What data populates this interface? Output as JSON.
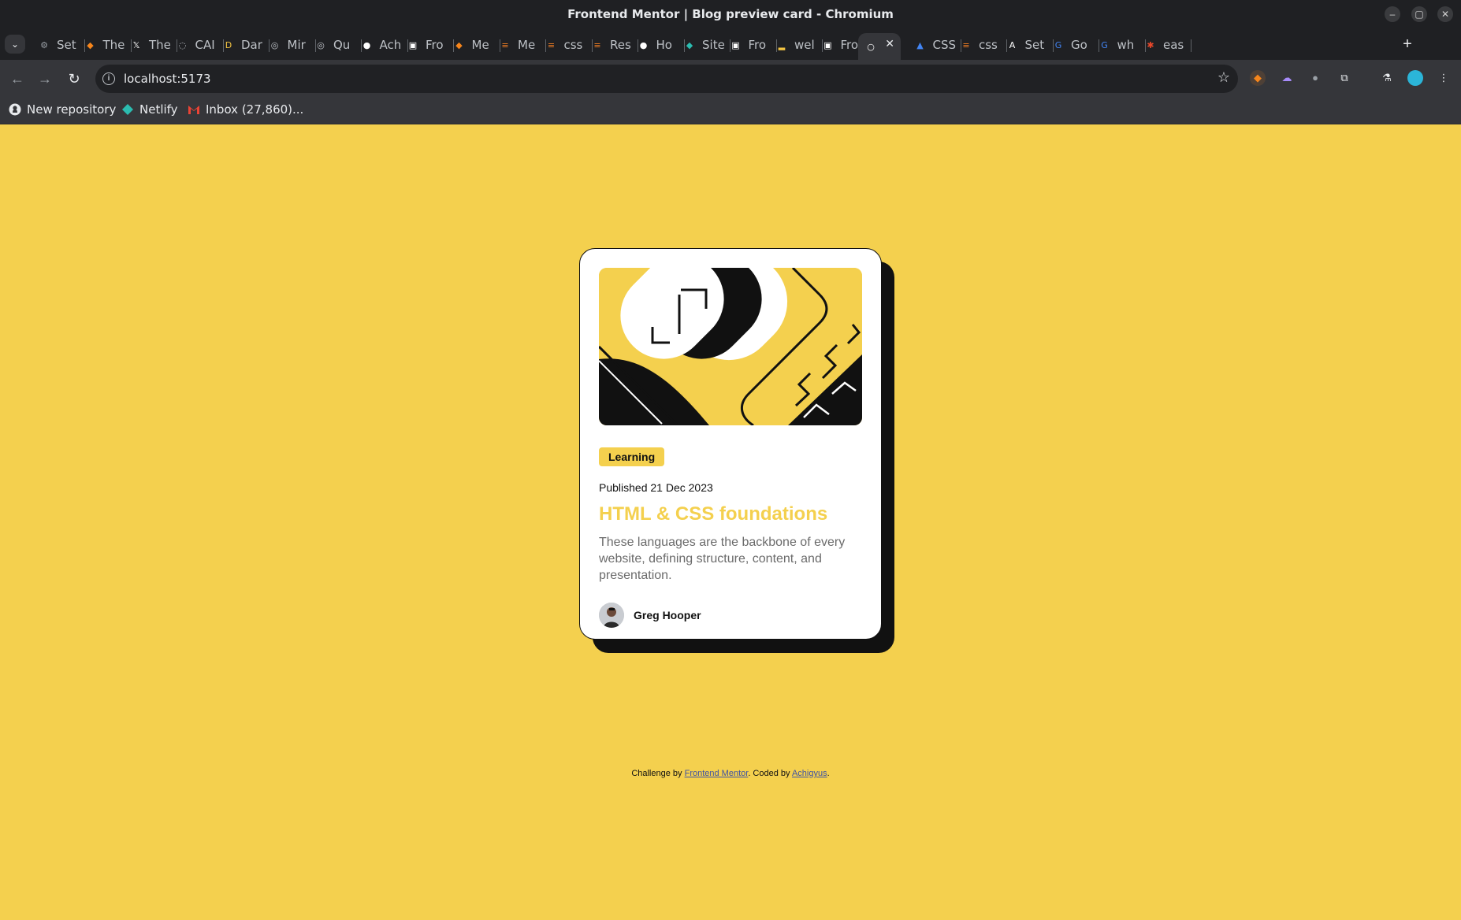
{
  "window": {
    "title": "Frontend Mentor | Blog preview card - Chromium",
    "controls": [
      "–",
      "▢",
      "✕"
    ]
  },
  "tabs": [
    {
      "label": "Set",
      "icon": "gear-icon",
      "color": "#9aa0a6"
    },
    {
      "label": "The",
      "icon": "metamask-icon",
      "color": "#f6851b"
    },
    {
      "label": "The",
      "icon": "x-icon",
      "color": "#ffffff"
    },
    {
      "label": "CAI",
      "icon": "globe-icon",
      "color": "#bdc1c6"
    },
    {
      "label": "Dar",
      "icon": "dart-icon",
      "color": "#f4c542"
    },
    {
      "label": "Mir",
      "icon": "spiral-icon",
      "color": "#bdc1c6"
    },
    {
      "label": "Qu",
      "icon": "spiral-icon",
      "color": "#bdc1c6"
    },
    {
      "label": "Ach",
      "icon": "github-icon",
      "color": "#ffffff"
    },
    {
      "label": "Fro",
      "icon": "frontend-mentor-icon",
      "color": "#ffffff"
    },
    {
      "label": "Me",
      "icon": "metamask-icon",
      "color": "#f6851b"
    },
    {
      "label": "Me",
      "icon": "stackoverflow-icon",
      "color": "#f48024"
    },
    {
      "label": "css",
      "icon": "stackoverflow-icon",
      "color": "#f48024"
    },
    {
      "label": "Res",
      "icon": "stackoverflow-icon",
      "color": "#f48024"
    },
    {
      "label": "Ho",
      "icon": "medium-icon",
      "color": "#ffffff"
    },
    {
      "label": "Site",
      "icon": "netlify-icon",
      "color": "#2bbcb0"
    },
    {
      "label": "Fro",
      "icon": "frontend-mentor-icon",
      "color": "#ffffff"
    },
    {
      "label": "wel",
      "icon": "bar-icon",
      "color": "#f4c542"
    },
    {
      "label": "Fro",
      "icon": "frontend-mentor-icon",
      "color": "#ffffff"
    },
    {
      "label": "",
      "icon": "page-icon",
      "color": "#ffffff",
      "active": true
    },
    {
      "label": "CSS",
      "icon": "person-icon",
      "color": "#4285f4"
    },
    {
      "label": "css",
      "icon": "stackoverflow-icon",
      "color": "#f48024"
    },
    {
      "label": "Set",
      "icon": "a-icon",
      "color": "#ffffff"
    },
    {
      "label": "Go",
      "icon": "google-icon",
      "color": "#4285f4"
    },
    {
      "label": "wh",
      "icon": "google-icon",
      "color": "#4285f4"
    },
    {
      "label": "eas",
      "icon": "asterisk-icon",
      "color": "#e8472a"
    }
  ],
  "toolbar": {
    "url": "localhost:5173"
  },
  "bookmarks": [
    {
      "label": "New repository",
      "icon": "github-icon"
    },
    {
      "label": "Netlify",
      "icon": "netlify-icon"
    },
    {
      "label": "Inbox (27,860)...",
      "icon": "gmail-icon"
    }
  ],
  "card": {
    "tag": "Learning",
    "published": "Published 21 Dec 2023",
    "title": "HTML & CSS foundations",
    "description": "These languages are the backbone of every website, defining structure, content, and presentation.",
    "author": "Greg Hooper"
  },
  "attribution": {
    "prefix": "Challenge by ",
    "link1": "Frontend Mentor",
    "middle": ". Coded by ",
    "link2": "Achigyus",
    "suffix": "."
  },
  "colors": {
    "accent": "#f4d04e",
    "ink": "#111111",
    "muted_text": "#6b6b6b"
  }
}
